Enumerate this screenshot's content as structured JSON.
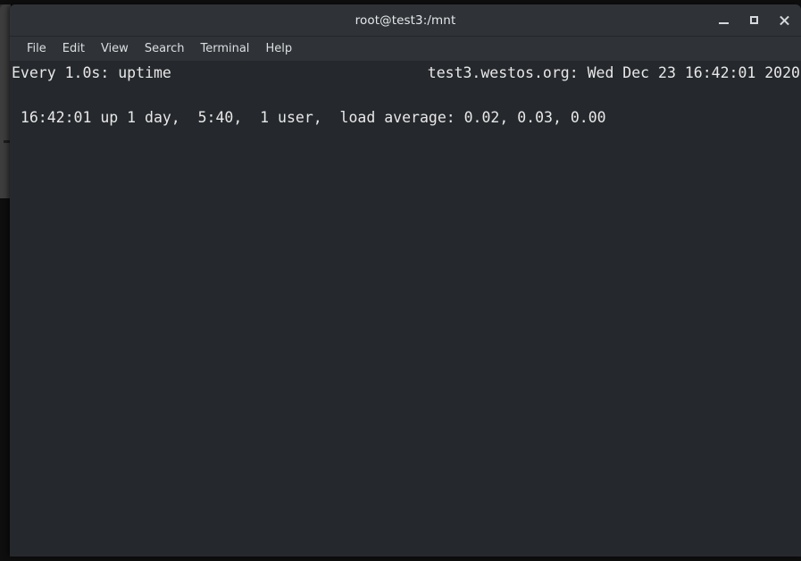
{
  "window": {
    "title": "root@test3:/mnt",
    "controls": [
      {
        "name": "minimize",
        "label": "_"
      },
      {
        "name": "maximize",
        "label": "□"
      },
      {
        "name": "close",
        "label": "✕"
      }
    ]
  },
  "menubar": {
    "items": [
      {
        "label": "File"
      },
      {
        "label": "Edit"
      },
      {
        "label": "View"
      },
      {
        "label": "Search"
      },
      {
        "label": "Terminal"
      },
      {
        "label": "Help"
      }
    ]
  },
  "terminal": {
    "watch_header_left": "Every 1.0s: uptime",
    "watch_header_right": "test3.westos.org: Wed Dec 23 16:42:01 2020",
    "output_line": " 16:42:01 up 1 day,  5:40,  1 user,  load average: 0.02, 0.03, 0.00"
  },
  "colors": {
    "titlebar_bg": "#2f3337",
    "menubar_bg": "#2f3337",
    "terminal_bg": "#25282c",
    "terminal_fg": "#e8e8e8",
    "desktop_bg": "#0f0e0e",
    "background_window": "#3d3d3d"
  }
}
